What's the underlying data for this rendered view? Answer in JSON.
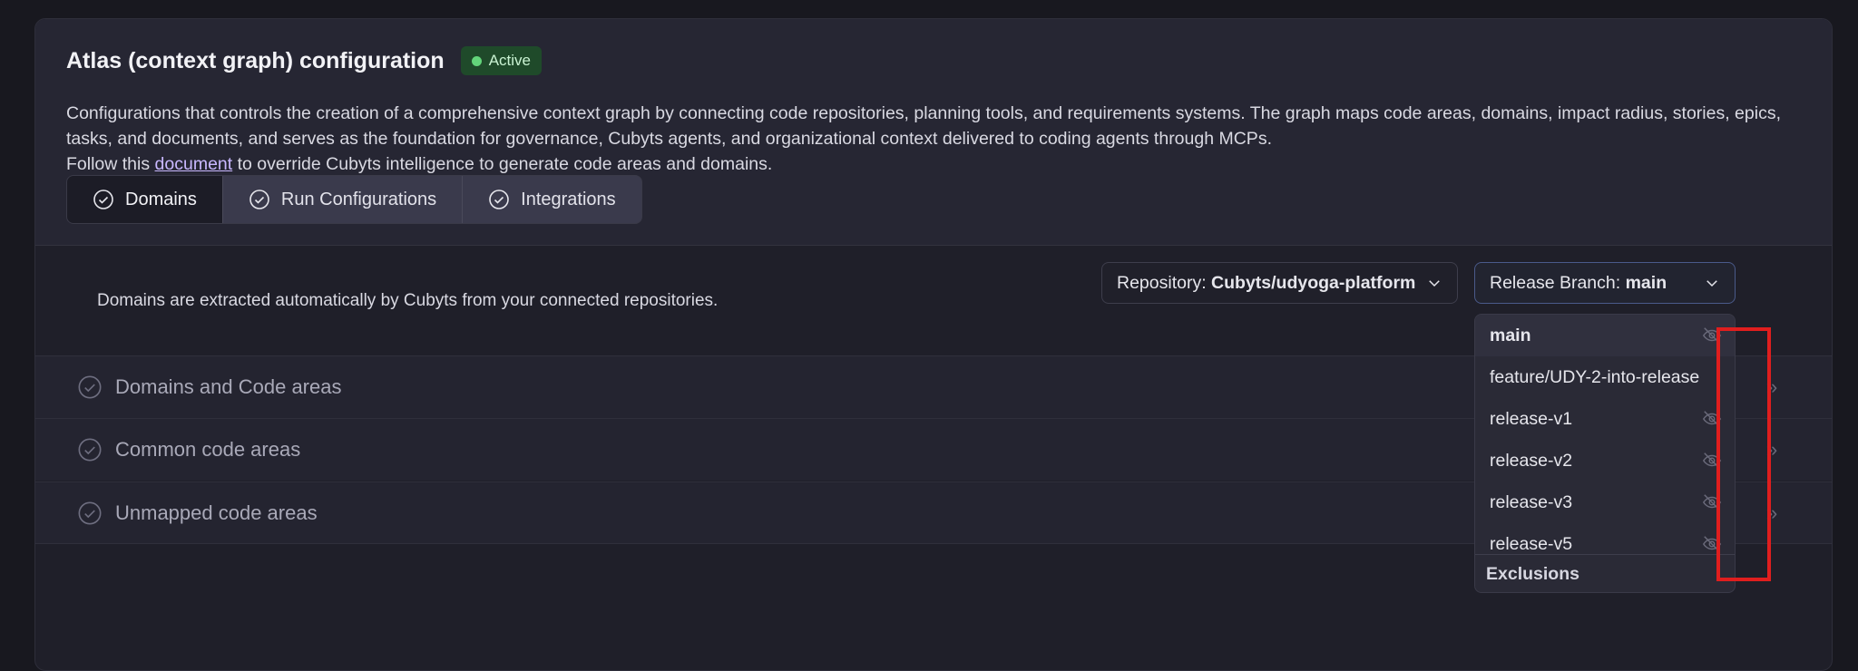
{
  "header": {
    "title": "Atlas (context graph) configuration",
    "status_badge": "Active",
    "description_line1": "Configurations that controls the creation of a comprehensive context graph by connecting code repositories, planning tools, and requirements systems. The graph maps code areas, domains, impact radius, stories, epics, tasks, and documents, and serves as the foundation for governance, Cubyts agents, and organizational context delivered to coding agents through MCPs.",
    "follow_prefix": "Follow this",
    "follow_link": "document",
    "follow_suffix": "to override Cubyts intelligence to generate code areas and domains."
  },
  "tabs": [
    {
      "label": "Domains",
      "active": true
    },
    {
      "label": "Run Configurations",
      "active": false
    },
    {
      "label": "Integrations",
      "active": false
    }
  ],
  "domains_panel": {
    "description": "Domains are extracted automatically by Cubyts from your connected repositories.",
    "repository_dropdown": {
      "prefix": "Repository:",
      "value": "Cubyts/udyoga-platform"
    },
    "branch_dropdown": {
      "prefix": "Release Branch:",
      "value": "main"
    },
    "sections": [
      {
        "label": "Domains and Code areas"
      },
      {
        "label": "Common code areas"
      },
      {
        "label": "Unmapped code areas"
      }
    ]
  },
  "branch_menu": {
    "items": [
      "main",
      "feature/UDY-2-into-release",
      "release-v1",
      "release-v2",
      "release-v3",
      "release-v5"
    ],
    "selected": "main",
    "footer": "Exclusions"
  },
  "icons": {
    "tab_icon": "check-circle-icon",
    "section_icon": "check-circle-icon",
    "menu_item_icon": "eye-off-icon",
    "dropdown_icon": "chevron-down-icon",
    "row_action_icon": "double-chevron-right-icon"
  },
  "colors": {
    "badge_bg": "#1f4a2a",
    "badge_dot": "#63d47a",
    "highlight_box": "#e01e1e",
    "link": "#c9b8ff"
  }
}
